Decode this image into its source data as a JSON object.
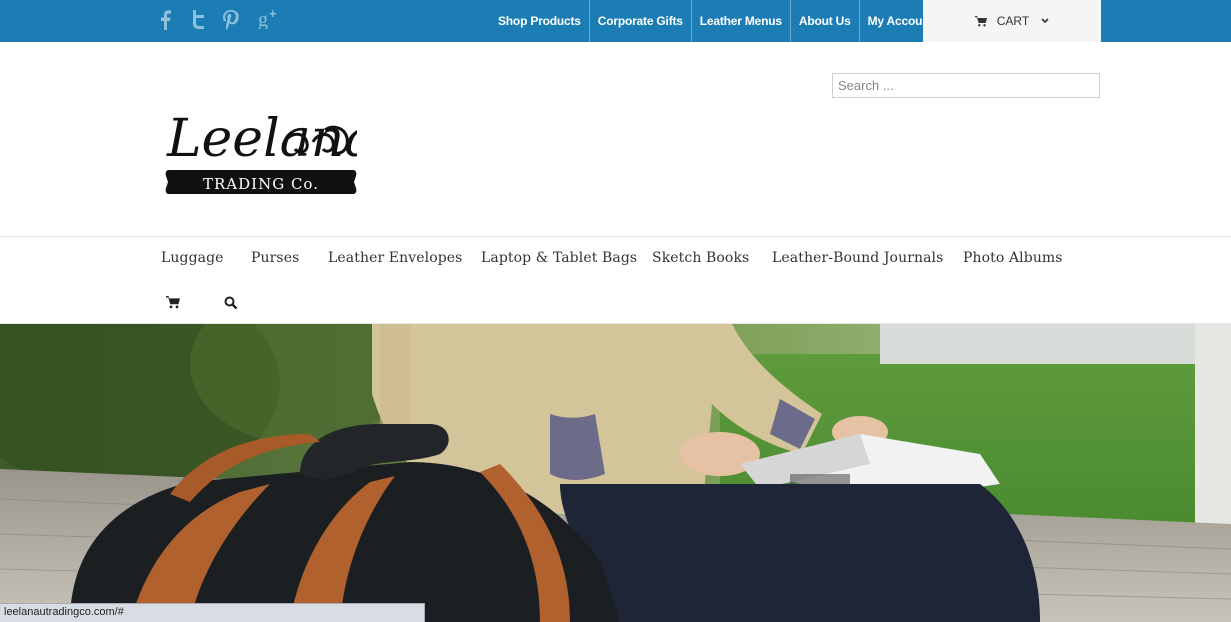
{
  "topbar": {
    "social": [
      {
        "name": "facebook-icon"
      },
      {
        "name": "twitter-icon"
      },
      {
        "name": "pinterest-icon"
      },
      {
        "name": "google-plus-icon"
      }
    ],
    "links": [
      "Shop Products",
      "Corporate Gifts",
      "Leather Menus",
      "About Us",
      "My Account"
    ],
    "cart_label": "CART"
  },
  "header": {
    "logo_title": "Leelanau",
    "logo_subtitle": "TRADING Co.",
    "search_placeholder": "Search ..."
  },
  "mainnav": {
    "items": [
      "Luggage",
      "Purses",
      "Leather Envelopes",
      "Laptop & Tablet Bags",
      "Sketch Books",
      "Leather-Bound Journals",
      "Photo Albums"
    ]
  },
  "status_bar": {
    "url": "leelanautradingco.com/#"
  },
  "colors": {
    "topbar": "#1c7db5",
    "cart_bg": "#f5f5f5"
  }
}
